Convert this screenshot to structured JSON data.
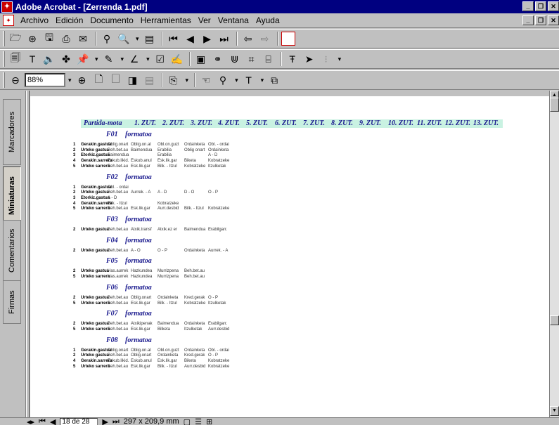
{
  "window": {
    "title": "Adobe Acrobat - [Zerrenda 1.pdf]"
  },
  "menu": [
    "Archivo",
    "Edición",
    "Documento",
    "Herramientas",
    "Ver",
    "Ventana",
    "Ayuda"
  ],
  "toolbar": {
    "zoom_value": "88%"
  },
  "nav_tabs": [
    "Marcadores",
    "Miniaturas",
    "Comentarios",
    "Firmas"
  ],
  "status": {
    "page": "18 de 28",
    "size": "297 x 209,9 mm"
  },
  "table": {
    "header_label": "Partida-mota",
    "columns": [
      "1. ZUT.",
      "2. ZUT.",
      "3. ZUT.",
      "4. ZUT.",
      "5. ZUT.",
      "6. ZUT.",
      "7. ZUT.",
      "8. ZUT.",
      "9. ZUT.",
      "10. ZUT.",
      "11. ZUT.",
      "12. ZUT.",
      "13. ZUT."
    ],
    "sections": [
      {
        "code": "F01",
        "label": "formatoa",
        "rows": [
          {
            "num": "1",
            "name": "Gerakin.gastua",
            "cells": [
              "Oblig.onart",
              "Oblig.on.al",
              "Obl.on.guzt",
              "Ordainketa",
              "Obl. - ordai"
            ]
          },
          {
            "num": "2",
            "name": "Urteko gastua",
            "cells": [
              "Beh.bet.au",
              "Baimendua",
              "Erabilia",
              "Oblig onart",
              "Ordainketa"
            ]
          },
          {
            "num": "3",
            "name": "Etorkiz.gastua",
            "cells": [
              "Baimendua",
              "",
              "Erabilia",
              "",
              "A - D"
            ]
          },
          {
            "num": "4",
            "name": "Gerakin.sarrera",
            "cells": [
              "Eskub.likid.",
              "Eskub.anul",
              "Esk.lik.gar",
              "Biketa",
              "Kobratzeke"
            ]
          },
          {
            "num": "5",
            "name": "Urteko sarrera",
            "cells": [
              "Beh.bet.au",
              "Esk.lik.gar",
              "Bilk. - Itzul",
              "Kobratzeke",
              "Itzulketak"
            ]
          }
        ]
      },
      {
        "code": "F02",
        "label": "formatoa",
        "rows": [
          {
            "num": "1",
            "name": "Gerakin.gastua",
            "cells": [
              "Obl. - ordai"
            ]
          },
          {
            "num": "2",
            "name": "Urteko gastua",
            "cells": [
              "Beh.bet.au",
              "Aurrek. - A",
              "A - D",
              "D - O",
              "O - P"
            ]
          },
          {
            "num": "3",
            "name": "Etorkiz.gastua",
            "cells": [
              "A - D"
            ]
          },
          {
            "num": "4",
            "name": "Gerakin.sarrera",
            "cells": [
              "Bilk. - Itzul",
              "",
              "Kobratzeke"
            ]
          },
          {
            "num": "5",
            "name": "Urteko sarrera",
            "cells": [
              "Beh.bet.au",
              "Esk.lik.gar",
              "Aurr.desbid",
              "Bilk. - Itzul",
              "Kobratzeke"
            ]
          }
        ]
      },
      {
        "code": "F03",
        "label": "formatoa",
        "rows": [
          {
            "num": "2",
            "name": "Urteko gastua",
            "cells": [
              "Beh.bet.au",
              "Atxik.transf",
              "Atxik.ez er",
              "Baimendua",
              "Erabilgarr."
            ]
          }
        ]
      },
      {
        "code": "F04",
        "label": "formatoa",
        "rows": [
          {
            "num": "2",
            "name": "Urteko gastua",
            "cells": [
              "Beh.bet.au",
              "A - O",
              "O - P",
              "Ordainketa",
              "Aurrek. - A"
            ]
          }
        ]
      },
      {
        "code": "F05",
        "label": "formatoa",
        "rows": [
          {
            "num": "2",
            "name": "Urteko gastua",
            "cells": [
              "Has.aurrek",
              "Hazkundea",
              "Murrizpena",
              "Beh.bet.au"
            ]
          },
          {
            "num": "5",
            "name": "Urteko sarrera",
            "cells": [
              "Has.aurrek",
              "Hazkundea",
              "Murrizpena",
              "Beh.bet.au"
            ]
          }
        ]
      },
      {
        "code": "F06",
        "label": "formatoa",
        "rows": [
          {
            "num": "2",
            "name": "Urteko gastua",
            "cells": [
              "Beh.bet.au",
              "Oblig.onart",
              "Ordainketa",
              "Kred.gerak",
              "O - P"
            ]
          },
          {
            "num": "5",
            "name": "Urteko sarrera",
            "cells": [
              "Beh.bet.au",
              "Esk.lik.gar",
              "Bilk. - Itzul",
              "Kobratzeke",
              "Itzulketak"
            ]
          }
        ]
      },
      {
        "code": "F07",
        "label": "formatoa",
        "rows": [
          {
            "num": "2",
            "name": "Urteko gastua",
            "cells": [
              "Beh.bet.au",
              "Atxikipenak",
              "Baimendua",
              "Ordainketa",
              "Erabilgarr."
            ]
          },
          {
            "num": "5",
            "name": "Urteko sarrera",
            "cells": [
              "Beh.bet.au",
              "Esk.lik.gar",
              "Bilketa",
              "Itzulketak",
              "Aurr.desbid"
            ]
          }
        ]
      },
      {
        "code": "F08",
        "label": "formatoa",
        "rows": [
          {
            "num": "1",
            "name": "Gerakin.gastua",
            "cells": [
              "Oblig.onart",
              "Oblig.on.al",
              "Obl.on.guzt",
              "Ordainketa",
              "Obl. - ordai"
            ]
          },
          {
            "num": "2",
            "name": "Urteko gastua",
            "cells": [
              "Beh.bet.au",
              "Oblig.onart",
              "Ordainketa",
              "Kred.gerak",
              "O - P"
            ]
          },
          {
            "num": "4",
            "name": "Gerakin.sarrera",
            "cells": [
              "Eskub.likid.",
              "Eskub.anul",
              "Esk.lik.gar",
              "Biketa",
              "Kobratzeke"
            ]
          },
          {
            "num": "5",
            "name": "Urteko sarrera",
            "cells": [
              "Beh.bet.au",
              "Esk.lik.gar",
              "Bilk. - Itzul",
              "Aurr.desbid",
              "Kobratzeke"
            ]
          }
        ]
      }
    ]
  }
}
